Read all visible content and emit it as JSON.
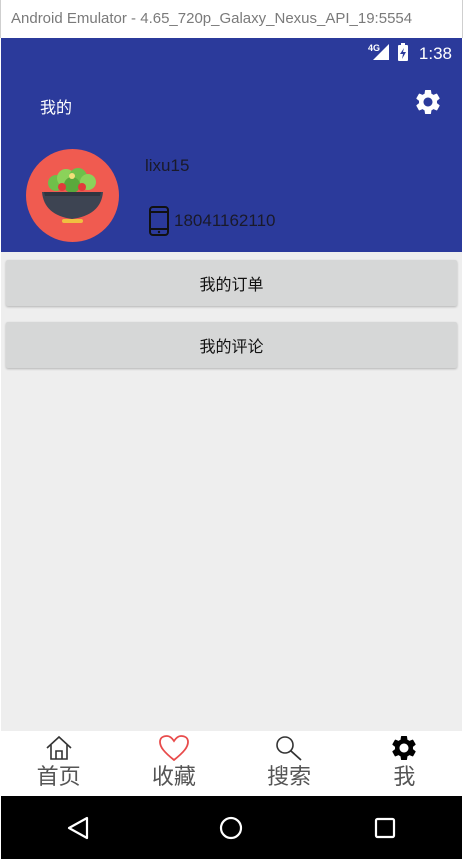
{
  "window": {
    "title": "Android Emulator - 4.65_720p_Galaxy_Nexus_API_19:5554"
  },
  "status_bar": {
    "network": "4G",
    "time": "1:38"
  },
  "header": {
    "title": "我的",
    "settings_icon": "gear-icon"
  },
  "profile": {
    "username": "lixu15",
    "phone": "18041162110",
    "avatar_icon": "salad-bowl-icon"
  },
  "menu": [
    {
      "label": "我的订单"
    },
    {
      "label": "我的评论"
    }
  ],
  "bottom_nav": [
    {
      "label": "首页",
      "icon": "home-icon"
    },
    {
      "label": "收藏",
      "icon": "heart-icon"
    },
    {
      "label": "搜索",
      "icon": "search-icon"
    },
    {
      "label": "我",
      "icon": "gear-icon",
      "active": true
    }
  ],
  "system_nav": [
    "back-icon",
    "home-circle-icon",
    "recents-icon"
  ],
  "colors": {
    "primary": "#2b3a9b",
    "avatar_bg": "#f05b50",
    "heart": "#e84b4b",
    "button_bg": "#d6d7d7"
  }
}
